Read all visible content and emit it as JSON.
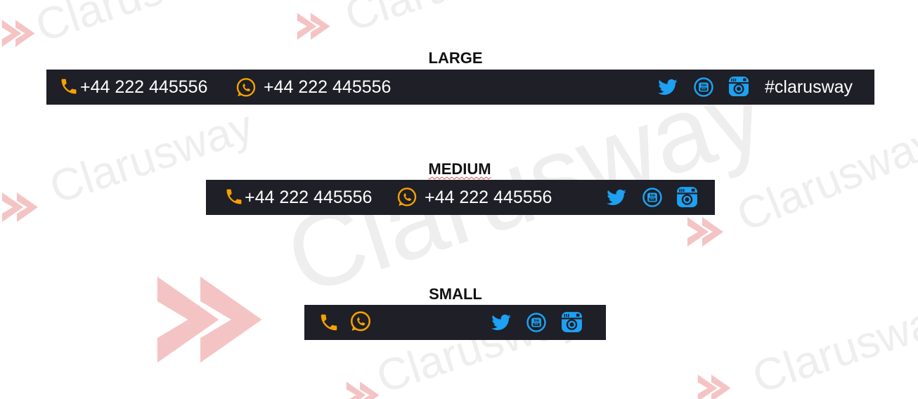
{
  "watermark": {
    "text": "Clarusway"
  },
  "colors": {
    "bar_bg": "#1e1f27",
    "accent_orange": "#f5a100",
    "accent_blue": "#1da1f2",
    "text_white": "#ffffff"
  },
  "sections": {
    "large": {
      "label": "LARGE",
      "phone": "+44 222 445556",
      "whatsapp": "+44 222 445556",
      "hashtag": "#clarusway",
      "icons": [
        "phone-icon",
        "whatsapp-icon",
        "twitter-icon",
        "youtube-icon",
        "instagram-icon"
      ]
    },
    "medium": {
      "label": "MEDIUM",
      "phone": "+44 222 445556",
      "whatsapp": "+44 222 445556",
      "icons": [
        "phone-icon",
        "whatsapp-icon",
        "twitter-icon",
        "youtube-icon",
        "instagram-icon"
      ]
    },
    "small": {
      "label": "SMALL",
      "icons": [
        "phone-icon",
        "whatsapp-icon",
        "twitter-icon",
        "youtube-icon",
        "instagram-icon"
      ]
    }
  }
}
